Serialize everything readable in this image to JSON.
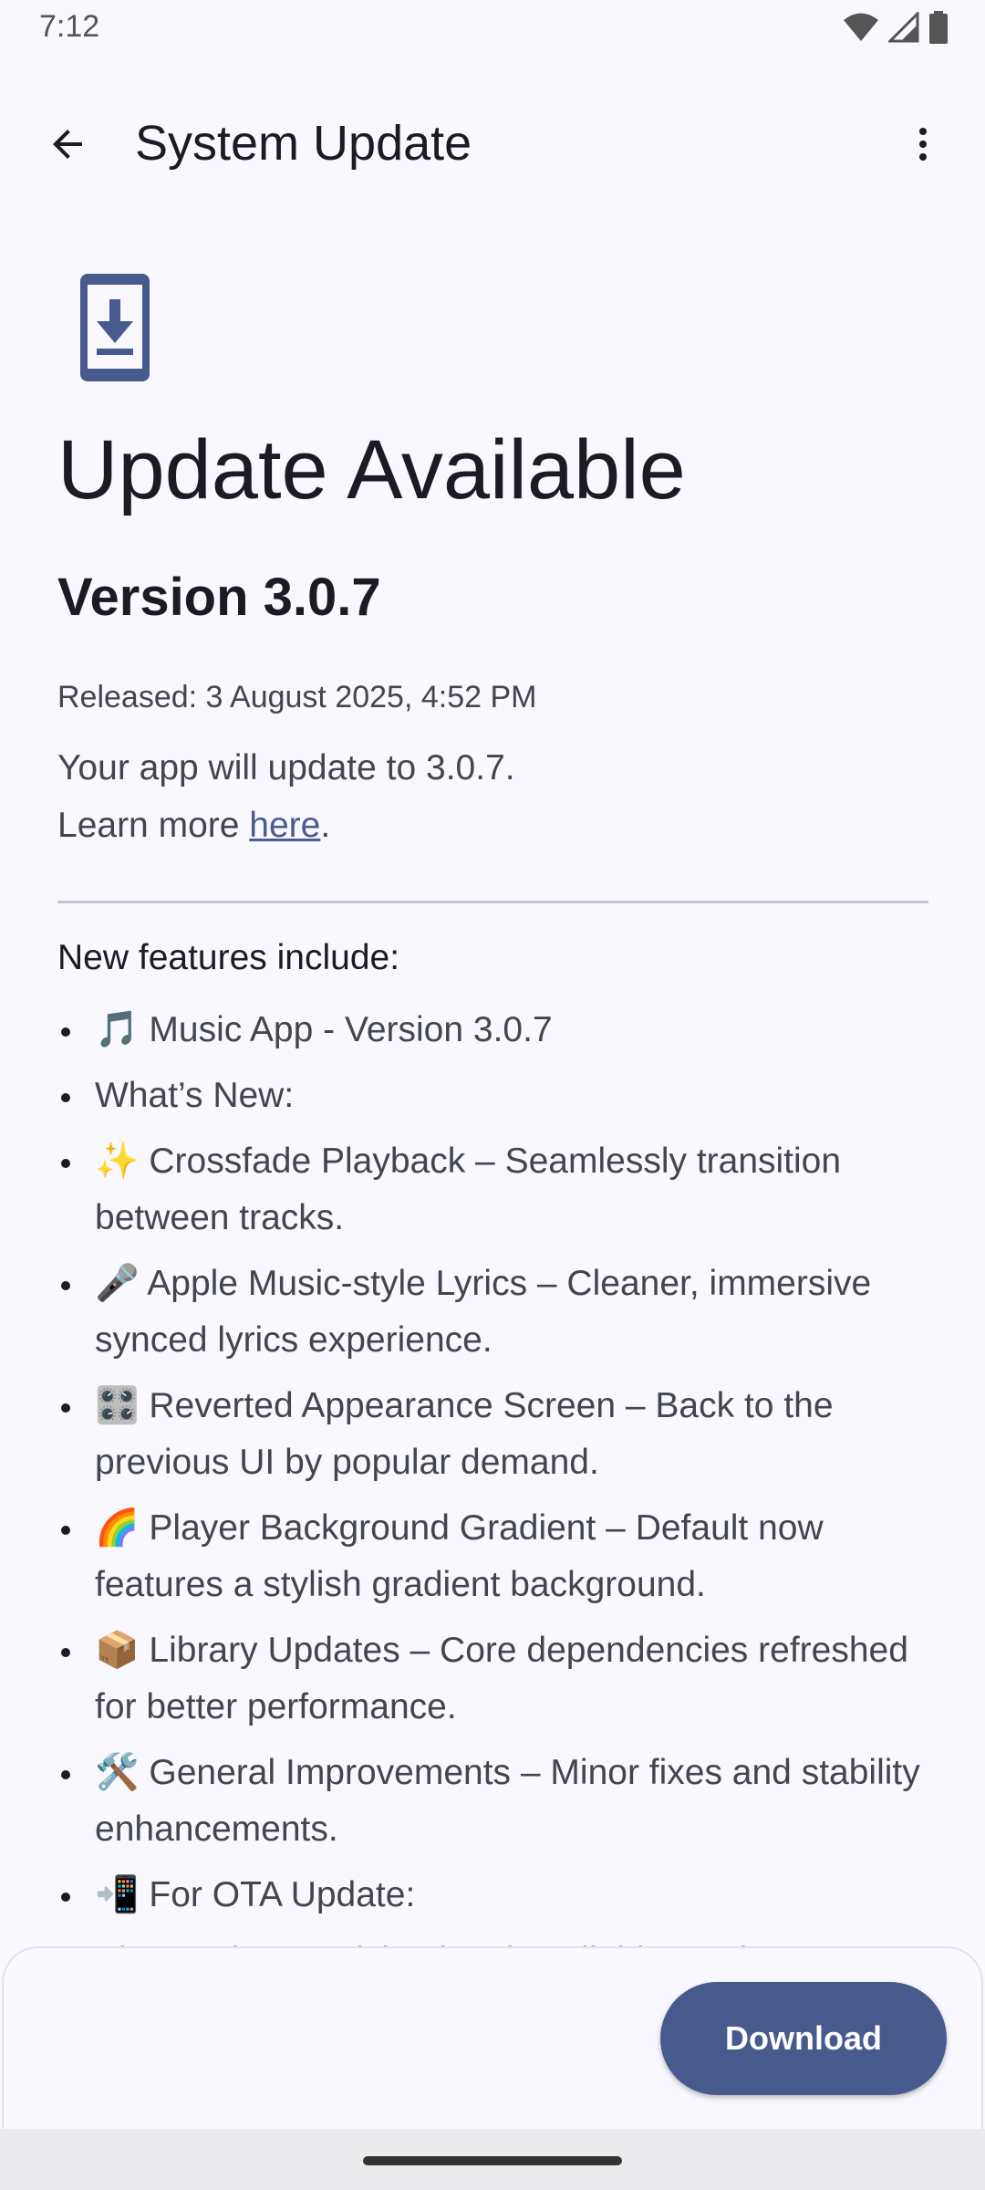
{
  "status_bar": {
    "time": "7:12",
    "icons": [
      "wifi-icon",
      "signal-icon",
      "battery-icon"
    ]
  },
  "app_bar": {
    "title": "System Update",
    "back_icon": "arrow-back-icon",
    "overflow_icon": "more-vert-icon"
  },
  "hero": {
    "icon": "phone-download-icon",
    "heading": "Update Available",
    "version": "Version 3.0.7",
    "released": "Released: 3 August 2025, 4:52 PM",
    "desc_line1": "Your app will update to 3.0.7.",
    "desc_learn_prefix": "Learn more ",
    "desc_link": "here",
    "desc_suffix": "."
  },
  "features": {
    "title": "New features include:",
    "items": [
      "🎵 Music App - Version 3.0.7",
      "What’s New:",
      "✨ Crossfade Playback – Seamlessly transition between tracks.",
      "🎤 Apple Music-style Lyrics – Cleaner, immersive synced lyrics experience.",
      "🎛️ Reverted Appearance Screen – Back to the previous UI by popular demand.",
      "🌈 Player Background Gradient – Default now features a stylish gradient background.",
      "📦 Library Updates – Core dependencies refreshed for better performance.",
      "🛠️ General Improvements – Minor fixes and stability enhancements.",
      "📲 For OTA Update:",
      "Please choose vivi.apk to install this version."
    ]
  },
  "actions": {
    "download_label": "Download"
  },
  "colors": {
    "background": "#f8f8fe",
    "primary": "#475a8d",
    "link": "#4a5a92",
    "on_surface": "#1b1b21",
    "on_surface_variant": "#44464f"
  }
}
